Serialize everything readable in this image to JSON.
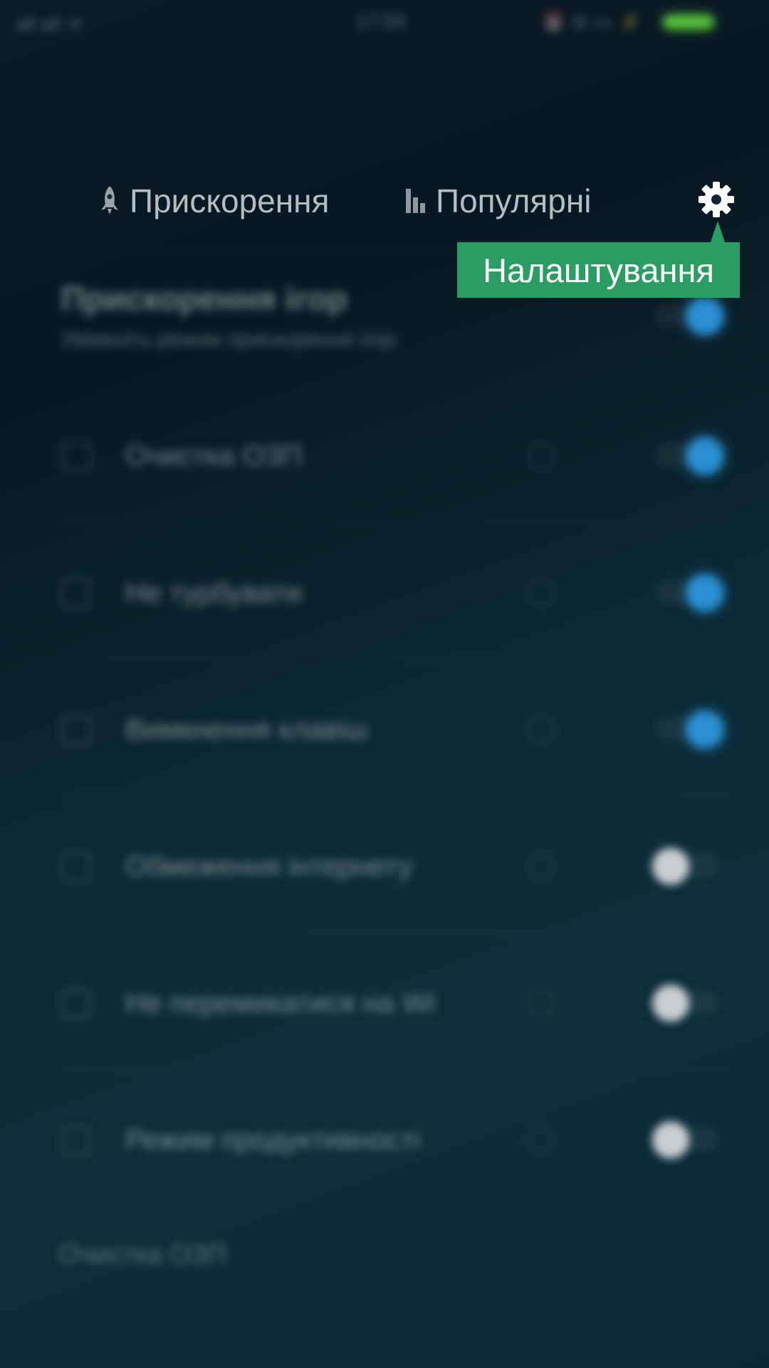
{
  "status_bar": {
    "left": "all all ᯤ",
    "time": "17:04",
    "right": "⏰ ⊘ ▭ ⚡"
  },
  "tabs": [
    {
      "label": "Прискорення",
      "icon": "rocket-icon"
    },
    {
      "label": "Популярні",
      "icon": "bar-chart-icon"
    }
  ],
  "settings": {
    "icon": "gear-icon",
    "tooltip": "Налаштування"
  },
  "section": {
    "title": "Прискорення ігор",
    "subtitle": "Увімкніть режим прискорення ігор"
  },
  "rows": [
    {
      "label": "Очистка ОЗП",
      "icon": "memory-icon",
      "toggle_on": true
    },
    {
      "label": "Не турбувати",
      "icon": "moon-icon",
      "toggle_on": true
    },
    {
      "label": "Вимкнення клавіш",
      "icon": "keys-icon",
      "toggle_on": true
    },
    {
      "label": "Обмеження інтернету",
      "icon": "wifi-icon",
      "toggle_on": false
    },
    {
      "label": "Не перемикатися на Wi",
      "icon": "switch-icon",
      "toggle_on": false
    },
    {
      "label": "Режим продуктивності",
      "icon": "performance-icon",
      "toggle_on": false
    }
  ],
  "footer": {
    "label": "Очистка ОЗП"
  },
  "colors": {
    "toggle_on": "#2a8fd2",
    "tooltip_bg": "#2a9d62",
    "battery": "#58c23b"
  }
}
